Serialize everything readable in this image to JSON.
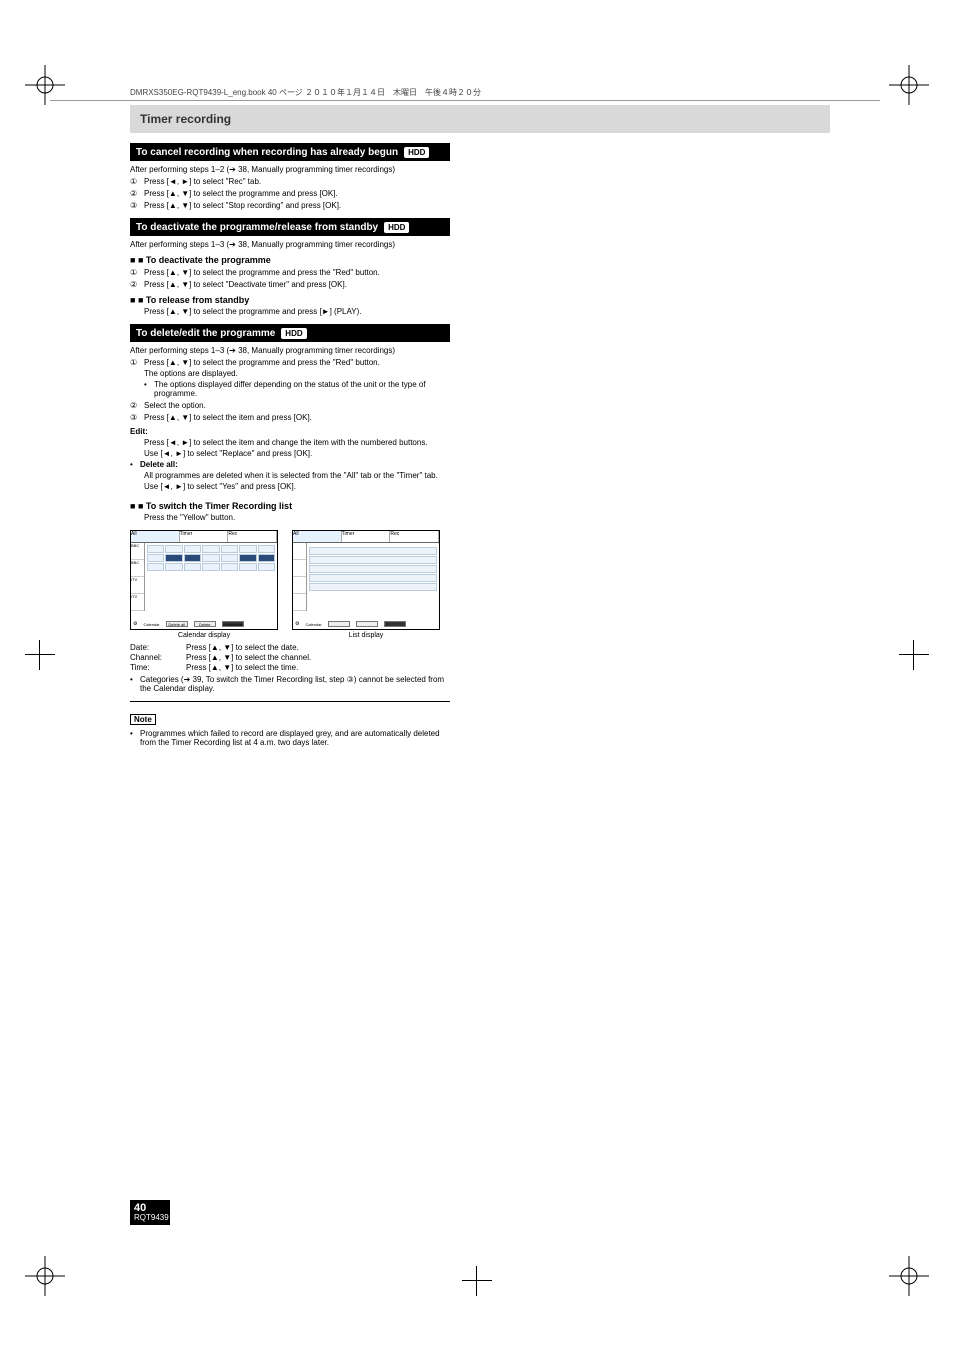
{
  "topbar": "DMRXS350EG-RQT9439-L_eng.book  40 ページ  ２０１０年１月１４日　木曜日　午後４時２０分",
  "header": "Timer recording",
  "sections": [
    {
      "title": "To cancel recording when recording has already begun",
      "badge": "HDD",
      "after": "After performing steps 1–2 (➔ 38, Manually programming timer recordings)",
      "steps": [
        {
          "num": "①",
          "text": "Press [◄, ►] to select \"Rec\" tab."
        },
        {
          "num": "②",
          "text": "Press [▲, ▼] to select the programme and press [OK]."
        },
        {
          "num": "③",
          "text": "Press [▲, ▼] to select \"Stop recording\" and press [OK]."
        }
      ]
    },
    {
      "title": "To deactivate the programme/release from standby",
      "badge": "HDD",
      "after": "After performing steps 1–3 (➔ 38, Manually programming timer recordings)",
      "blocks": [
        {
          "heading": "■ To deactivate the programme",
          "steps": [
            {
              "num": "①",
              "text": "Press [▲, ▼] to select the programme and press the \"Red\" button."
            },
            {
              "num": "②",
              "text": "Press [▲, ▼] to select \"Deactivate timer\" and press [OK]."
            }
          ]
        },
        {
          "heading": "■ To release from standby",
          "plain": "Press [▲, ▼] to select the programme and press [►] (PLAY)."
        }
      ]
    },
    {
      "title": "To delete/edit the programme",
      "badge": "HDD",
      "after": "After performing steps 1–3 (➔ 38, Manually programming timer recordings)",
      "steps": [
        {
          "num": "①",
          "text": "Press [▲, ▼] to select the programme and press the \"Red\" button."
        },
        {
          "sub": "The options are displayed."
        },
        {
          "bullet": "The options displayed differ depending on the status of the unit or the type of programme."
        },
        {
          "num": "②",
          "text": "Select the option."
        },
        {
          "num": "③",
          "text": "Press [▲, ▼] to select the item and press [OK]."
        }
      ],
      "items": [
        {
          "name": "Edit:",
          "desc": "Press [◄, ►] to select the item and change the item with the numbered buttons.",
          "extra": "Use [◄, ►] to select \"Replace\" and press [OK]."
        },
        {
          "name": "Delete all:",
          "desc": "All programmes are deleted when it is selected from the \"All\" tab or the \"Timer\" tab.",
          "extra": "Use [◄, ►] to select \"Yes\" and press [OK]."
        }
      ],
      "switch": {
        "heading": "■ To switch the Timer Recording list",
        "text": "Press the \"Yellow\" button.",
        "diagram_labels": {
          "left_title": "Calendar display",
          "right_title": "List display",
          "tabs": [
            "All",
            "Timer",
            "Rec"
          ],
          "side": [
            "BBC",
            "BBC",
            "ITV",
            "ITV"
          ],
          "footer_buttons": [
            "Delete all",
            "Delete",
            "Deactivate"
          ],
          "footer_label": "Calendar"
        },
        "explain_rows": [
          {
            "label": "Date:",
            "text": "Press [▲, ▼] to select the date."
          },
          {
            "label": "Channel:",
            "text": "Press [▲, ▼] to select the channel."
          },
          {
            "label": "Time:",
            "text": "Press [▲, ▼] to select the time."
          }
        ],
        "cat_bullet": "Categories (➔ 39, To switch the Timer Recording list, step ③) cannot be selected from the Calendar display."
      }
    }
  ],
  "note": {
    "label": "Note",
    "text": "Programmes which failed to record are displayed grey, and are automatically deleted from the Timer Recording list at 4 a.m. two days later."
  },
  "page_number": {
    "big": "40",
    "small": "RQT9439"
  }
}
